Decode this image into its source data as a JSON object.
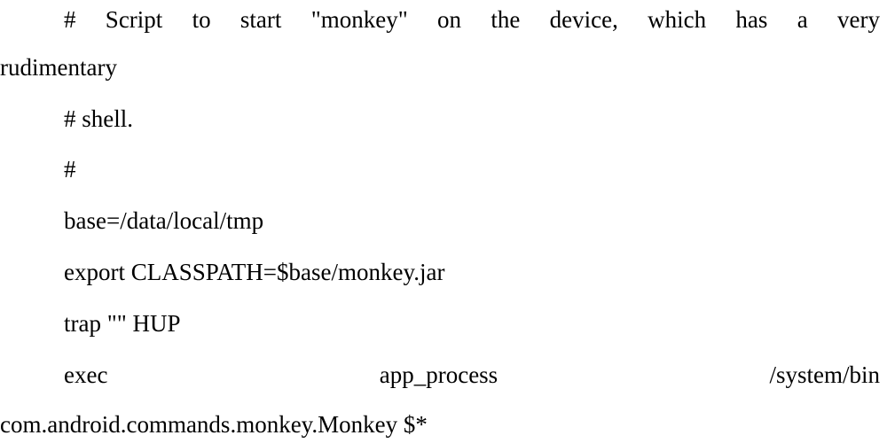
{
  "document": {
    "lines": [
      {
        "words": [
          "#",
          "Script",
          "to",
          "start",
          "\"monkey\"",
          "on",
          "the",
          "device,",
          "which",
          "has",
          "a",
          "very"
        ]
      },
      {
        "text": "rudimentary"
      },
      {
        "text": "# shell."
      },
      {
        "text": "#"
      },
      {
        "text": "base=/data/local/tmp"
      },
      {
        "text": "export CLASSPATH=$base/monkey.jar"
      },
      {
        "text": "trap \"\" HUP"
      },
      {
        "words": [
          "exec",
          "app_process",
          "/system/bin"
        ]
      },
      {
        "text": "com.android.commands.monkey.Monkey $*"
      }
    ]
  }
}
